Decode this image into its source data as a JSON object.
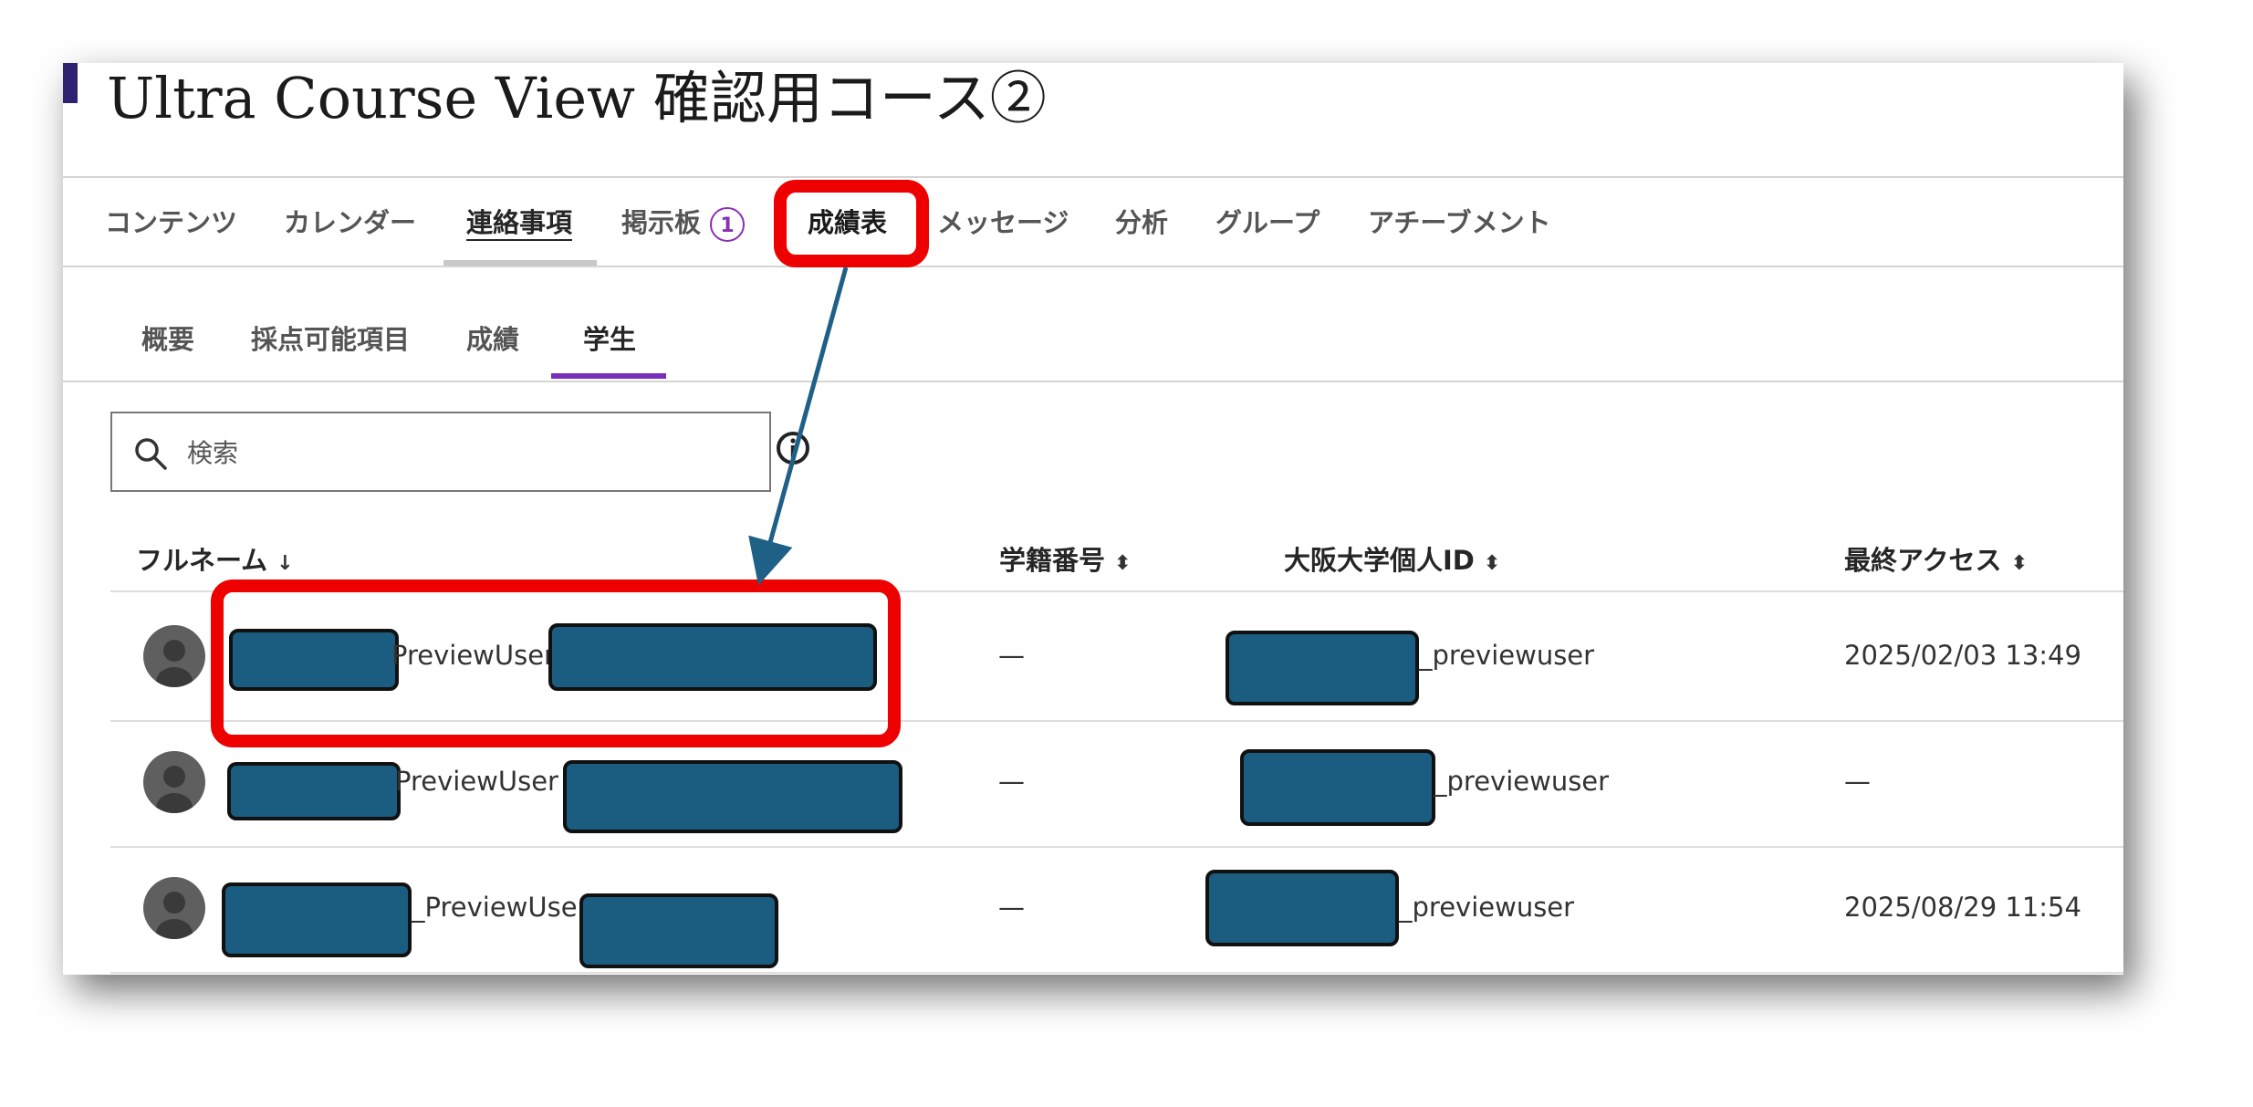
{
  "course": {
    "title": "Ultra Course View 確認用コース②"
  },
  "nav": {
    "tabs": [
      "コンテンツ",
      "カレンダー",
      "連絡事項",
      "掲示板",
      "成績表",
      "メッセージ",
      "分析",
      "グループ",
      "アチーブメント"
    ],
    "badge_count": "1",
    "active": "連絡事項"
  },
  "subnav": {
    "tabs": [
      "概要",
      "採点可能項目",
      "成績",
      "学生"
    ],
    "active": "学生"
  },
  "search": {
    "placeholder": "検索"
  },
  "table": {
    "headers": [
      "フルネーム",
      "学籍番号",
      "大阪大学個人ID",
      "最終アクセス"
    ],
    "rows": [
      {
        "name_fragment": "PreviewUser",
        "student_no": "—",
        "id_suffix": "_previewuser",
        "last_access": "2025/02/03 13:49"
      },
      {
        "name_fragment": "PreviewUser",
        "student_no": "—",
        "id_suffix": "_previewuser",
        "last_access": "—"
      },
      {
        "name_fragment": "_PreviewUser",
        "student_no": "—",
        "id_suffix": "_previewuser",
        "last_access": "2025/08/29 11:54"
      }
    ]
  },
  "colors": {
    "accent": "#2f2270",
    "active_tab": "#7a2fb8",
    "highlight": "#ee0000",
    "redaction": "#1a5d80",
    "arrow": "#1f6087"
  },
  "icons": {
    "search": "search-icon",
    "info": "info-icon",
    "sort": "sort-icon",
    "avatar": "avatar-icon"
  }
}
